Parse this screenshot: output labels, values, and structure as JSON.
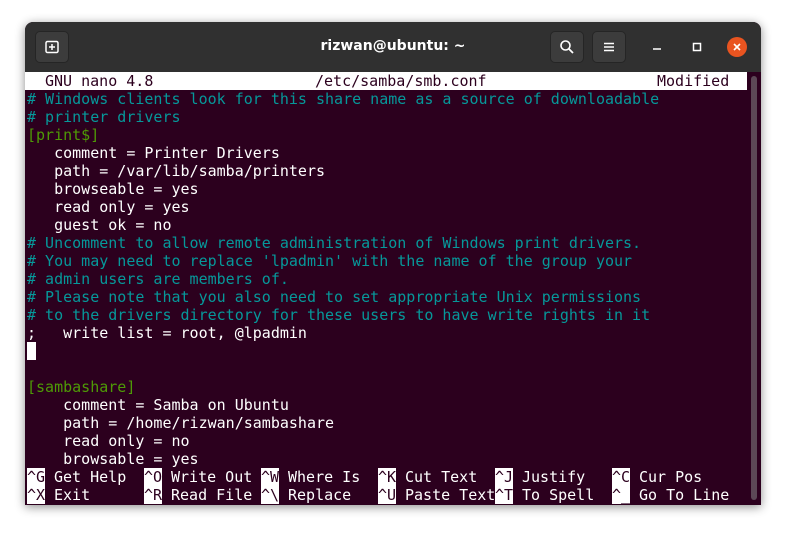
{
  "window": {
    "title": "rizwan@ubuntu: ~"
  },
  "nano": {
    "version": "GNU nano 4.8",
    "filename": "/etc/samba/smb.conf",
    "state": "Modified"
  },
  "lines": [
    {
      "text": "# Windows clients look for this share name as a source of downloadable",
      "type": "comment"
    },
    {
      "text": "# printer drivers",
      "type": "comment"
    },
    {
      "text": "[print$]",
      "type": "section"
    },
    {
      "text": "   comment = Printer Drivers",
      "type": "normal"
    },
    {
      "text": "   path = /var/lib/samba/printers",
      "type": "normal"
    },
    {
      "text": "   browseable = yes",
      "type": "normal"
    },
    {
      "text": "   read only = yes",
      "type": "normal"
    },
    {
      "text": "   guest ok = no",
      "type": "normal"
    },
    {
      "text": "# Uncomment to allow remote administration of Windows print drivers.",
      "type": "comment"
    },
    {
      "text": "# You may need to replace 'lpadmin' with the name of the group your",
      "type": "comment"
    },
    {
      "text": "# admin users are members of.",
      "type": "comment"
    },
    {
      "text": "# Please note that you also need to set appropriate Unix permissions",
      "type": "comment"
    },
    {
      "text": "# to the drivers directory for these users to have write rights in it",
      "type": "comment"
    },
    {
      "text": ";   write list = root, @lpadmin",
      "type": "normal"
    },
    {
      "text": "",
      "type": "normal"
    },
    {
      "text": "",
      "type": "normal"
    },
    {
      "text": "[sambashare]",
      "type": "section"
    },
    {
      "text": "    comment = Samba on Ubuntu",
      "type": "normal"
    },
    {
      "text": "    path = /home/rizwan/sambashare",
      "type": "normal"
    },
    {
      "text": "    read only = no",
      "type": "normal"
    },
    {
      "text": "    browsable = yes",
      "type": "normal"
    }
  ],
  "shortcuts_row1": [
    {
      "key": "^G",
      "label": "Get Help"
    },
    {
      "key": "^O",
      "label": "Write Out"
    },
    {
      "key": "^W",
      "label": "Where Is"
    },
    {
      "key": "^K",
      "label": "Cut Text"
    },
    {
      "key": "^J",
      "label": "Justify"
    },
    {
      "key": "^C",
      "label": "Cur Pos"
    }
  ],
  "shortcuts_row2": [
    {
      "key": "^X",
      "label": "Exit"
    },
    {
      "key": "^R",
      "label": "Read File"
    },
    {
      "key": "^\\",
      "label": "Replace"
    },
    {
      "key": "^U",
      "label": "Paste Text"
    },
    {
      "key": "^T",
      "label": "To Spell"
    },
    {
      "key": "^_",
      "label": "Go To Line"
    }
  ],
  "colors": {
    "terminal_bg": "#2c001e",
    "titlebar_bg": "#303030",
    "comment": "#06989a",
    "section": "#4e9a06",
    "close_button": "#e95420"
  },
  "icons": {
    "new_tab": "new-tab-icon",
    "search": "search-icon",
    "menu": "hamburger-menu-icon",
    "minimize": "minimize-icon",
    "maximize": "maximize-icon",
    "close": "close-icon"
  }
}
